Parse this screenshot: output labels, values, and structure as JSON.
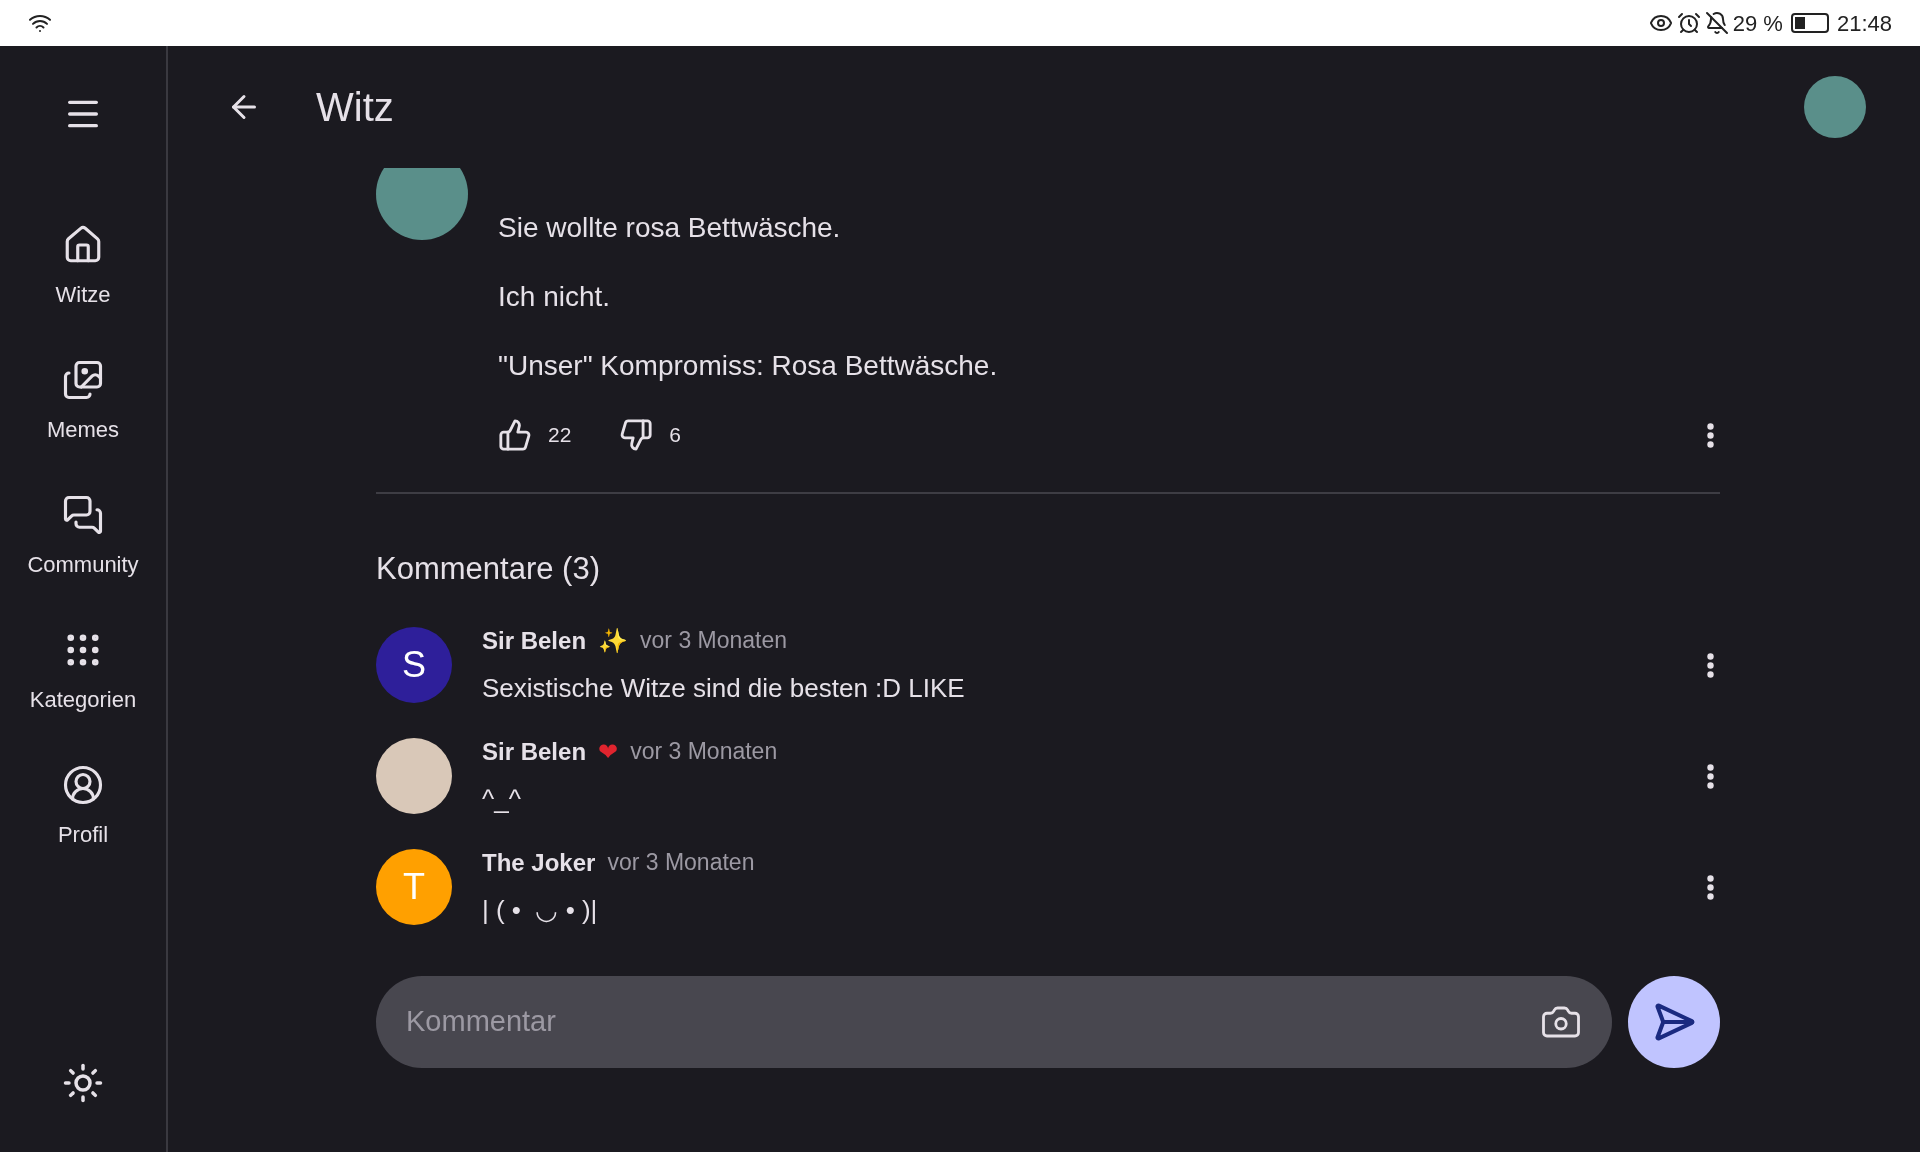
{
  "status_bar": {
    "battery": "29 %",
    "time": "21:48"
  },
  "sidebar": {
    "items": [
      {
        "kind": "home",
        "label": "Witze",
        "selected": false
      },
      {
        "kind": "images",
        "label": "Memes",
        "selected": false
      },
      {
        "kind": "forum",
        "label": "Community",
        "selected": false
      },
      {
        "kind": "grid",
        "label": "Kategorien",
        "selected": false
      },
      {
        "kind": "profile",
        "label": "Profil",
        "selected": false
      }
    ]
  },
  "header": {
    "title": "Witz"
  },
  "post": {
    "lines": [
      "Sie wollte rosa Bettwäsche.",
      "Ich nicht.",
      "\"Unser\" Kompromiss: Rosa Bettwäsche."
    ],
    "likes": "22",
    "dislikes": "6"
  },
  "comments_title": "Kommentare (3)",
  "comments": [
    {
      "author": "Sir Belen",
      "badge": {
        "text": "✨"
      },
      "time": "vor 3 Monaten",
      "text": "Sexistische Witze sind die besten :D LIKE",
      "avatar": {
        "kind": "letter",
        "letter": "S",
        "color": "#2e1f9a"
      }
    },
    {
      "author": "Sir Belen",
      "badge": {
        "text": "❤",
        "color": "#e0242e"
      },
      "time": "vor 3 Monaten",
      "text": "^_^",
      "avatar": {
        "kind": "photo"
      }
    },
    {
      "author": "The Joker",
      "time": "vor 3 Monaten",
      "text": "| ( •  ◡ • )|",
      "avatar": {
        "kind": "letter",
        "letter": "T",
        "color": "#ffa000"
      }
    }
  ],
  "composer": {
    "placeholder": "Kommentar"
  }
}
